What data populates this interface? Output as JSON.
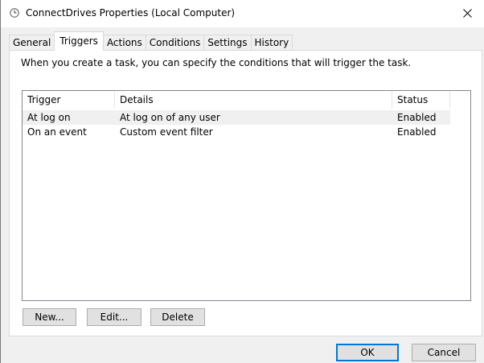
{
  "window": {
    "title": "ConnectDrives Properties (Local Computer)"
  },
  "tabs": [
    {
      "label": "General"
    },
    {
      "label": "Triggers"
    },
    {
      "label": "Actions"
    },
    {
      "label": "Conditions"
    },
    {
      "label": "Settings"
    },
    {
      "label": "History"
    }
  ],
  "active_tab": "Triggers",
  "triggers_panel": {
    "description": "When you create a task, you can specify the conditions that will trigger the task.",
    "columns": [
      "Trigger",
      "Details",
      "Status"
    ],
    "rows": [
      {
        "trigger": "At log on",
        "details": "At log on of any user",
        "status": "Enabled"
      },
      {
        "trigger": "On an event",
        "details": "Custom event filter",
        "status": "Enabled"
      }
    ],
    "buttons": {
      "new": "New...",
      "edit": "Edit...",
      "delete": "Delete"
    }
  },
  "footer": {
    "ok": "OK",
    "cancel": "Cancel"
  },
  "colors": {
    "accent": "#0078d7",
    "selection": "#f0f0f0",
    "panel_border": "#d9d9d9"
  },
  "icons": {
    "title": "clock-icon",
    "close": "close-icon"
  }
}
